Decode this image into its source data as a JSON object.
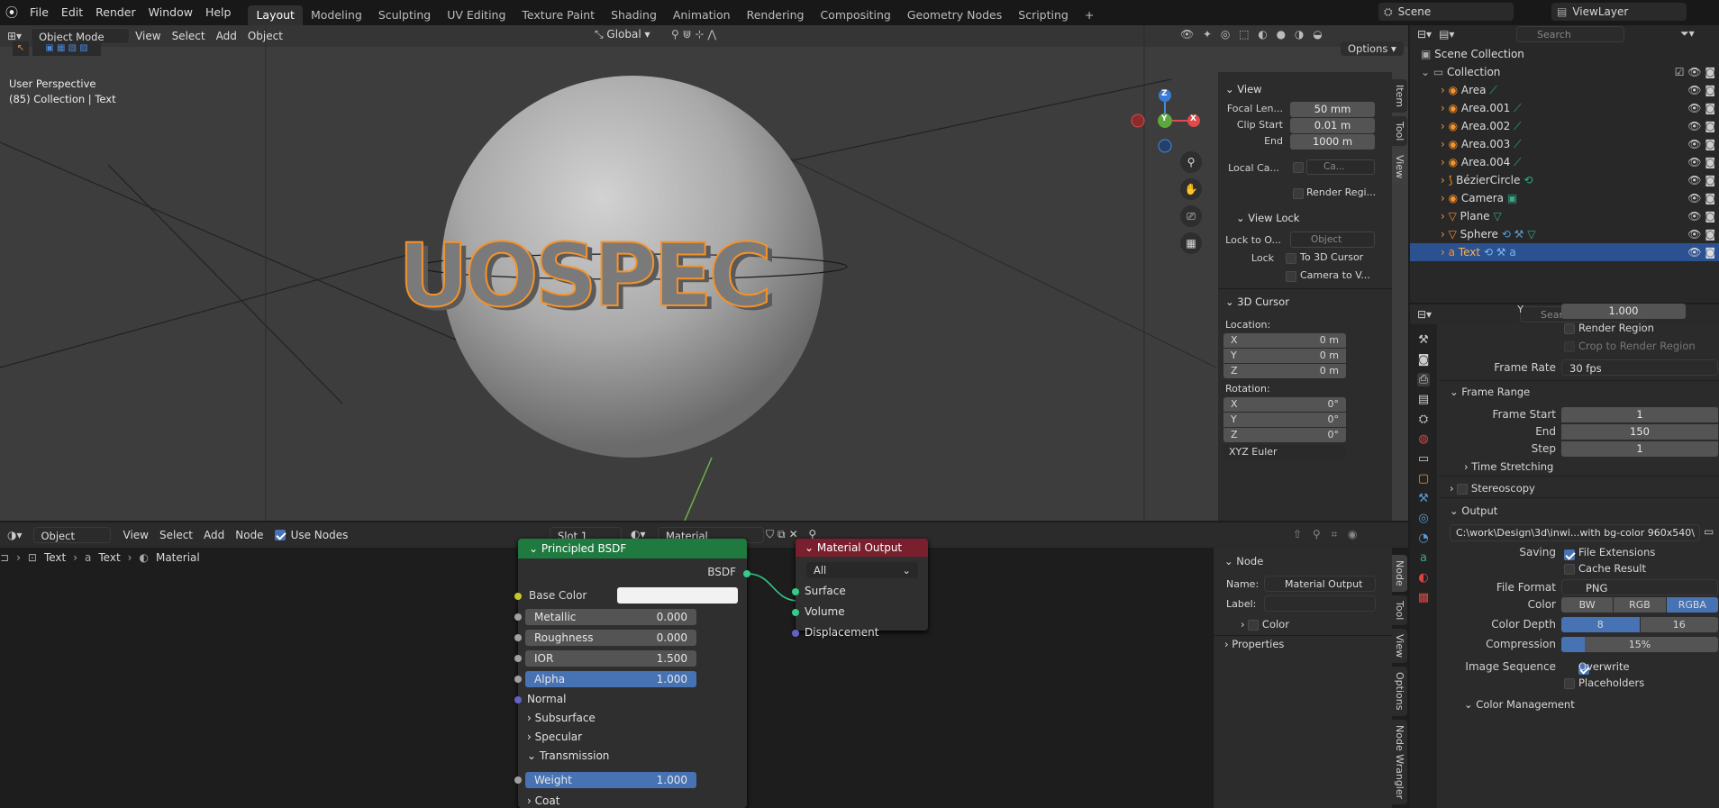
{
  "menu": [
    "File",
    "Edit",
    "Render",
    "Window",
    "Help"
  ],
  "workspaces": [
    "Layout",
    "Modeling",
    "Sculpting",
    "UV Editing",
    "Texture Paint",
    "Shading",
    "Animation",
    "Rendering",
    "Compositing",
    "Geometry Nodes",
    "Scripting"
  ],
  "add_tab": "+",
  "scene": {
    "name": "Scene",
    "view_layer": "ViewLayer"
  },
  "viewport": {
    "mode": "Object Mode",
    "menu": [
      "View",
      "Select",
      "Add",
      "Object"
    ],
    "transform": "Global",
    "options": "Options",
    "overlay_title": "User Perspective",
    "overlay_sub": "(85) Collection | Text",
    "text3d": "UOSPEC",
    "gizmo": {
      "x": "X",
      "y": "Y",
      "z": "Z"
    }
  },
  "npanel": {
    "view_header": "View",
    "focal_label": "Focal Len...",
    "focal": "50 mm",
    "clip_start_label": "Clip Start",
    "clip_start": "0.01 m",
    "end_label": "End",
    "end": "1000 m",
    "local_cam_label": "Local Ca...",
    "local_cam_value": "Ca...",
    "render_region": "Render Regi...",
    "view_lock_header": "View Lock",
    "lock_to_label": "Lock to O...",
    "lock_to_value": "Object",
    "lock_label": "Lock",
    "to_cursor": "To 3D Cursor",
    "camera_to": "Camera to V...",
    "cursor_header": "3D Cursor",
    "location_label": "Location:",
    "loc": [
      {
        "axis": "X",
        "value": "0 m"
      },
      {
        "axis": "Y",
        "value": "0 m"
      },
      {
        "axis": "Z",
        "value": "0 m"
      }
    ],
    "rotation_label": "Rotation:",
    "rot": [
      {
        "axis": "X",
        "value": "0°"
      },
      {
        "axis": "Y",
        "value": "0°"
      },
      {
        "axis": "Z",
        "value": "0°"
      }
    ],
    "rot_mode": "XYZ Euler",
    "tabs": [
      "Item",
      "Tool",
      "View"
    ]
  },
  "outliner": {
    "search_placeholder": "Search",
    "scene_collection": "Scene Collection",
    "collection": "Collection",
    "items": [
      "Area",
      "Area.001",
      "Area.002",
      "Area.003",
      "Area.004",
      "BézierCircle",
      "Camera",
      "Plane",
      "Sphere",
      "Text"
    ]
  },
  "properties": {
    "search_placeholder": "Search",
    "y_label": "Y",
    "y_value": "1.000",
    "render_region": "Render Region",
    "crop": "Crop to Render Region",
    "frame_rate_label": "Frame Rate",
    "frame_rate": "30 fps",
    "frame_range": "Frame Range",
    "frame_start_label": "Frame Start",
    "frame_start": "1",
    "end_label": "End",
    "end": "150",
    "step_label": "Step",
    "step": "1",
    "time_stretching": "Time Stretching",
    "stereoscopy": "Stereoscopy",
    "output": "Output",
    "path": "C:\\work\\Design\\3d\\inwi...with bg-color 960x540\\",
    "saving_label": "Saving",
    "file_ext": "File Extensions",
    "cache": "Cache Result",
    "file_format_label": "File Format",
    "file_format": "PNG",
    "color_label": "Color",
    "color_opts": [
      "BW",
      "RGB",
      "RGBA"
    ],
    "depth_label": "Color Depth",
    "depth_opts": [
      "8",
      "16"
    ],
    "compression_label": "Compression",
    "compression": "15%",
    "image_seq_label": "Image Sequence",
    "overwrite": "Overwrite",
    "placeholders": "Placeholders",
    "color_mgmt": "Color Management"
  },
  "node_editor": {
    "editor": "Object",
    "menu": [
      "View",
      "Select",
      "Add",
      "Node"
    ],
    "use_nodes": "Use Nodes",
    "slot": "Slot 1",
    "material": "Material",
    "breadcrumb": [
      "Text",
      "Text",
      "Material"
    ],
    "bsdf": {
      "title": "Principled BSDF",
      "out": "BSDF",
      "base_color": "Base Color",
      "rows": [
        {
          "label": "Metallic",
          "value": "0.000"
        },
        {
          "label": "Roughness",
          "value": "0.000"
        },
        {
          "label": "IOR",
          "value": "1.500"
        },
        {
          "label": "Alpha",
          "value": "1.000"
        }
      ],
      "normal": "Normal",
      "subsurface": "Subsurface",
      "specular": "Specular",
      "transmission": "Transmission",
      "weight_label": "Weight",
      "weight": "1.000",
      "coat": "Coat"
    },
    "output_node": {
      "title": "Material Output",
      "target": "All",
      "surface": "Surface",
      "volume": "Volume",
      "displacement": "Displacement"
    },
    "side": {
      "node_header": "Node",
      "name_label": "Name:",
      "name_value": "Material Output",
      "label_label": "Label:",
      "color": "Color",
      "properties": "Properties"
    },
    "tabs": [
      "Node",
      "Tool",
      "View",
      "Options",
      "Node Wrangler"
    ]
  },
  "colors": {
    "accent": "#4772b3",
    "selection_orange": "#f5922a",
    "bsdf_header": "#1e7a3e",
    "output_header": "#7a1f2e"
  }
}
